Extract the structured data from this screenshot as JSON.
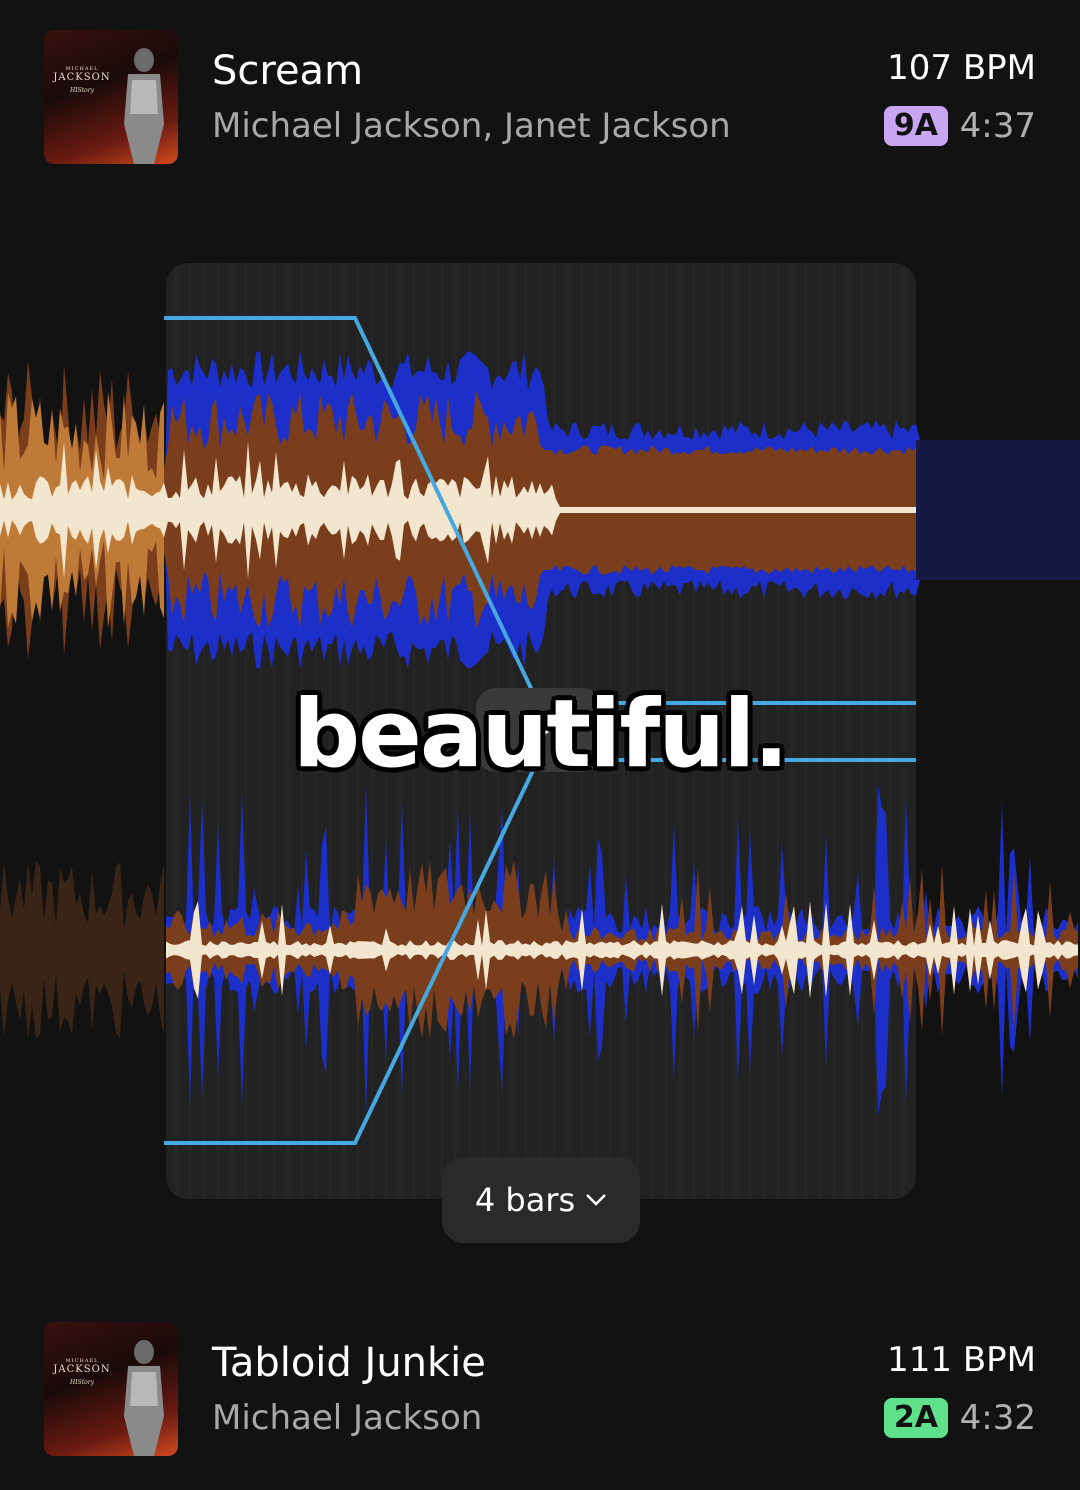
{
  "tracks": [
    {
      "title": "Scream",
      "artist": "Michael Jackson, Janet Jackson",
      "bpm": "107 BPM",
      "key": "9A",
      "key_color": "#c9a6f2",
      "duration": "4:37",
      "art_text": {
        "line1": "MICHAEL",
        "line2": "JACKSON",
        "line3": "HIStory"
      }
    },
    {
      "title": "Tabloid Junkie",
      "artist": "Michael Jackson",
      "bpm": "111 BPM",
      "key": "2A",
      "key_color": "#5fe08a",
      "duration": "4:32",
      "art_text": {
        "line1": "MICHAEL",
        "line2": "JACKSON",
        "line3": "HIStory"
      }
    }
  ],
  "transition": {
    "bars_label": "4 bars",
    "caption": "beautiful."
  },
  "colors": {
    "background": "#121212",
    "panel": "#222222",
    "automation_line": "#45a8e0",
    "wave_blue": "#1c2fc8",
    "wave_brown": "#7a3e1c",
    "wave_orange": "#c07a38",
    "wave_cream": "#f3e6cf"
  },
  "icons": {
    "bars_dropdown": "chevron-down-icon",
    "play": "play-icon"
  }
}
